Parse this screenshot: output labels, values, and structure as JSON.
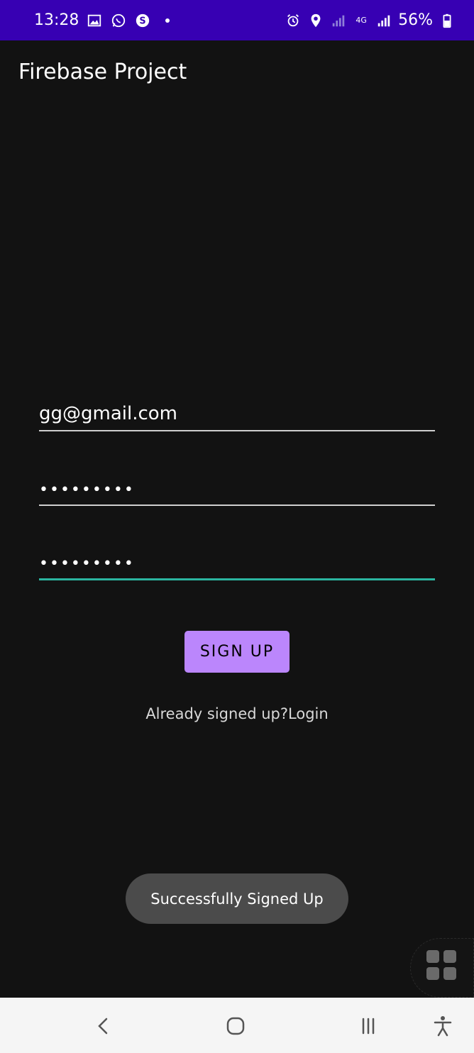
{
  "status_bar": {
    "time": "13:28",
    "battery": "56%",
    "network_label": "4G",
    "icons": [
      "gallery-icon",
      "whatsapp-icon",
      "s-app-icon",
      "alarm-icon",
      "location-icon",
      "signal-icon",
      "signal-icon",
      "battery-icon"
    ]
  },
  "app_bar": {
    "title": "Firebase Project"
  },
  "form": {
    "email_value": "gg@gmail.com",
    "password_value": "•••••••••",
    "confirm_password_value": "•••••••••",
    "signup_label": "SIGN UP",
    "login_link": "Already signed up?Login"
  },
  "toast": {
    "message": "Successfully Signed Up"
  },
  "colors": {
    "status_bar": "#3700b3",
    "background": "#121212",
    "button": "#bb86fc",
    "focus_underline": "#2bb5a0"
  }
}
